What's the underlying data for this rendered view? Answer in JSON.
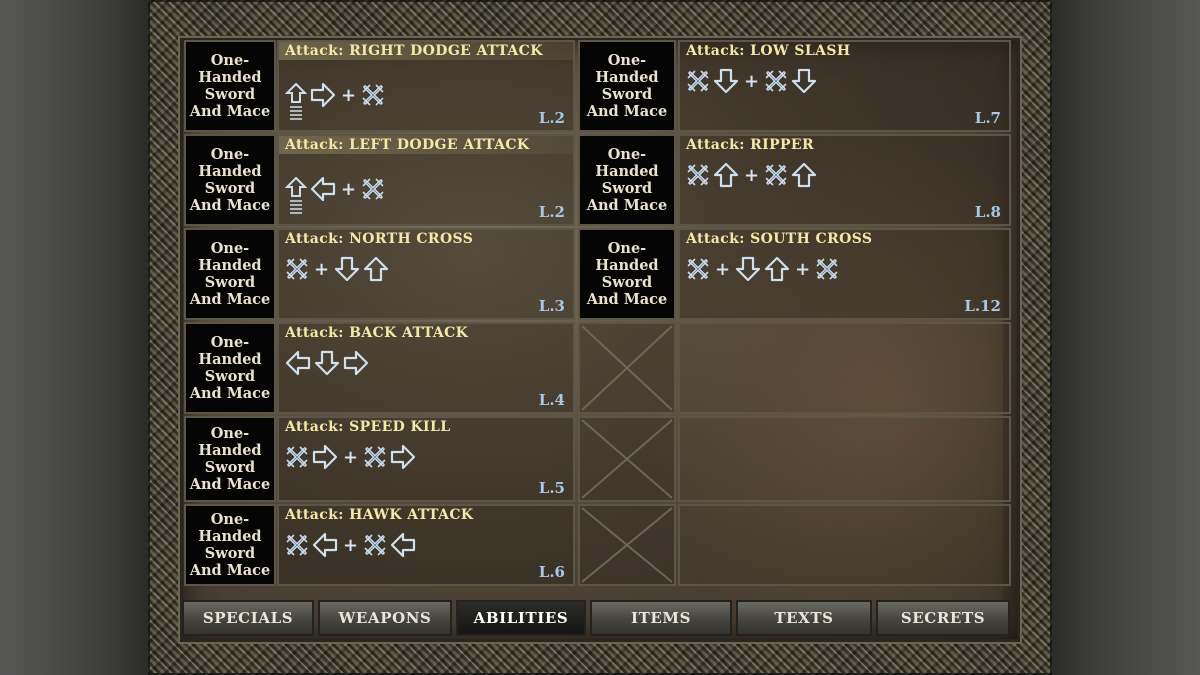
{
  "weapon_label": [
    "One-",
    "Handed",
    "Sword",
    "And Mace"
  ],
  "colors": {
    "title": "#f2e9a8",
    "level": "#a9c8e8",
    "arrow": "#cfdfee"
  },
  "left_moves": [
    {
      "title": "Attack: RIGHT DODGE ATTACK",
      "level": "L.2",
      "highlight": true,
      "combo": [
        "up-dodge",
        "right",
        "plus",
        "sword"
      ]
    },
    {
      "title": "Attack: LEFT DODGE ATTACK",
      "level": "L.2",
      "highlight": true,
      "combo": [
        "up-dodge",
        "left",
        "plus",
        "sword"
      ]
    },
    {
      "title": "Attack: NORTH CROSS",
      "level": "L.3",
      "highlight": false,
      "combo": [
        "sword",
        "plus",
        "down",
        "up"
      ]
    },
    {
      "title": "Attack: BACK ATTACK",
      "level": "L.4",
      "highlight": false,
      "combo": [
        "left",
        "down",
        "right"
      ]
    },
    {
      "title": "Attack: SPEED KILL",
      "level": "L.5",
      "highlight": false,
      "combo": [
        "sword",
        "right",
        "plus",
        "sword",
        "right"
      ]
    },
    {
      "title": "Attack: HAWK ATTACK",
      "level": "L.6",
      "highlight": false,
      "combo": [
        "sword",
        "left",
        "plus",
        "sword",
        "left"
      ]
    }
  ],
  "right_moves": [
    {
      "title": "Attack: LOW SLASH",
      "level": "L.7",
      "highlight": false,
      "combo": [
        "sword",
        "down",
        "plus",
        "sword",
        "down"
      ]
    },
    {
      "title": "Attack: RIPPER",
      "level": "L.8",
      "highlight": false,
      "combo": [
        "sword",
        "up",
        "plus",
        "sword",
        "up"
      ]
    },
    {
      "title": "Attack: SOUTH CROSS",
      "level": "L.12",
      "highlight": false,
      "combo": [
        "sword",
        "plus",
        "down",
        "up",
        "plus",
        "sword"
      ]
    }
  ],
  "tabs": [
    {
      "label": "SPECIALS",
      "active": false
    },
    {
      "label": "WEAPONS",
      "active": false
    },
    {
      "label": "ABILITIES",
      "active": true
    },
    {
      "label": "ITEMS",
      "active": false
    },
    {
      "label": "TEXTS",
      "active": false
    },
    {
      "label": "SECRETS",
      "active": false
    }
  ]
}
